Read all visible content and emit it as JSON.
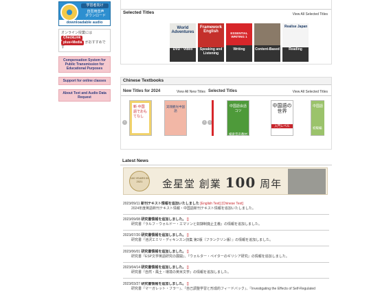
{
  "sidebar": {
    "audio_top": "学習者向け",
    "audio_jp1": "自習用音声",
    "audio_jp2": "ダウンロード",
    "audio_dl": "downloadable audio",
    "online_text1": "オンライン授業には",
    "online_tag1": "CheckLink",
    "online_tag2": "plus+Media",
    "online_text2": "がおすすめです",
    "link1": "Compensation System for Public Transmission for Educational Purposes",
    "link2": "Support for online classes",
    "link3": "About Text and Audio Data Request"
  },
  "selected": {
    "title": "Selected Titles",
    "view_all": "View All Selected Titles",
    "categories": [
      {
        "label": "DVD · Video",
        "img_text": "World Adventures",
        "color": "#2f4f6b"
      },
      {
        "label": "Speaking and Listening",
        "img_text": "Framework English",
        "color": "#c4302b"
      },
      {
        "label": "Writing",
        "img_text": "ESSENTIAL WRITING 1",
        "color": "#d7262a"
      },
      {
        "label": "Content-Based",
        "img_text": "",
        "color": "#7b6a5a"
      },
      {
        "label": "Reading",
        "img_text": "Realise Japan",
        "color": "#f1f1f1"
      }
    ]
  },
  "chinese": {
    "title": "Chinese Textbooks",
    "new_title": "New Titles for 2024",
    "view_all_new": "View All New Titles",
    "sel_title": "Selected Titles",
    "view_all_sel": "View All Selected Titles",
    "book1": "新·中国語でおもてなし",
    "book2": "実践観光中国語",
    "book3": "中国語会話 コツ",
    "book3_sub": "検索音声教材",
    "book4": "中国語の世界",
    "book4_sub": "入門レベル",
    "book5": "中国語",
    "book5_sub": "初級編"
  },
  "news": {
    "title": "Latest News",
    "banner_badge": "100 YEARS IN 2021",
    "banner_text1": "金星堂 創業",
    "banner_num": "100",
    "banner_text2": "周年",
    "items": [
      {
        "date": "2023/09/11",
        "title": "新刊テキスト情報を追加いたしました",
        "links": "[English Text] [Chinese Text]",
        "desc": "2024年度英語新刊テキスト情報・中国語新刊テキスト情報を追加いたしました。"
      },
      {
        "date": "2023/09/08",
        "title": "研究書情報を追加しました。",
        "links": "[]",
        "desc": "研究書『ラルフ・ウォルドー・エマソンと奴隷制廃止主義』の情報を追加しました。"
      },
      {
        "date": "2023/07/20",
        "title": "研究書情報を追加しました。",
        "links": "[]",
        "desc": "研究書『池沢エミリ・ディキンスン詩集 第2版（フランクリン版）』の情報を追加しました。"
      },
      {
        "date": "2023/06/01",
        "title": "研究書情報を追加しました。",
        "links": "[]",
        "desc": "研究書『ESP文学英語研究の展開』、『ウォルター・ペイターのギリシア研究』の情報を追加しました。"
      },
      {
        "date": "2023/04/14",
        "title": "研究書情報を追加しました。",
        "links": "[]",
        "desc": "研究書『自然・風土・環境の英米文学』の情報を追加しました。"
      },
      {
        "date": "2023/03/27",
        "title": "研究書情報を追加しました。",
        "links": "[]",
        "desc": "研究書『マーガレット・フラー』、『自己調整学習と形成的フィードバック』、『Investigating the Effects of Self-Regulated"
      }
    ]
  }
}
